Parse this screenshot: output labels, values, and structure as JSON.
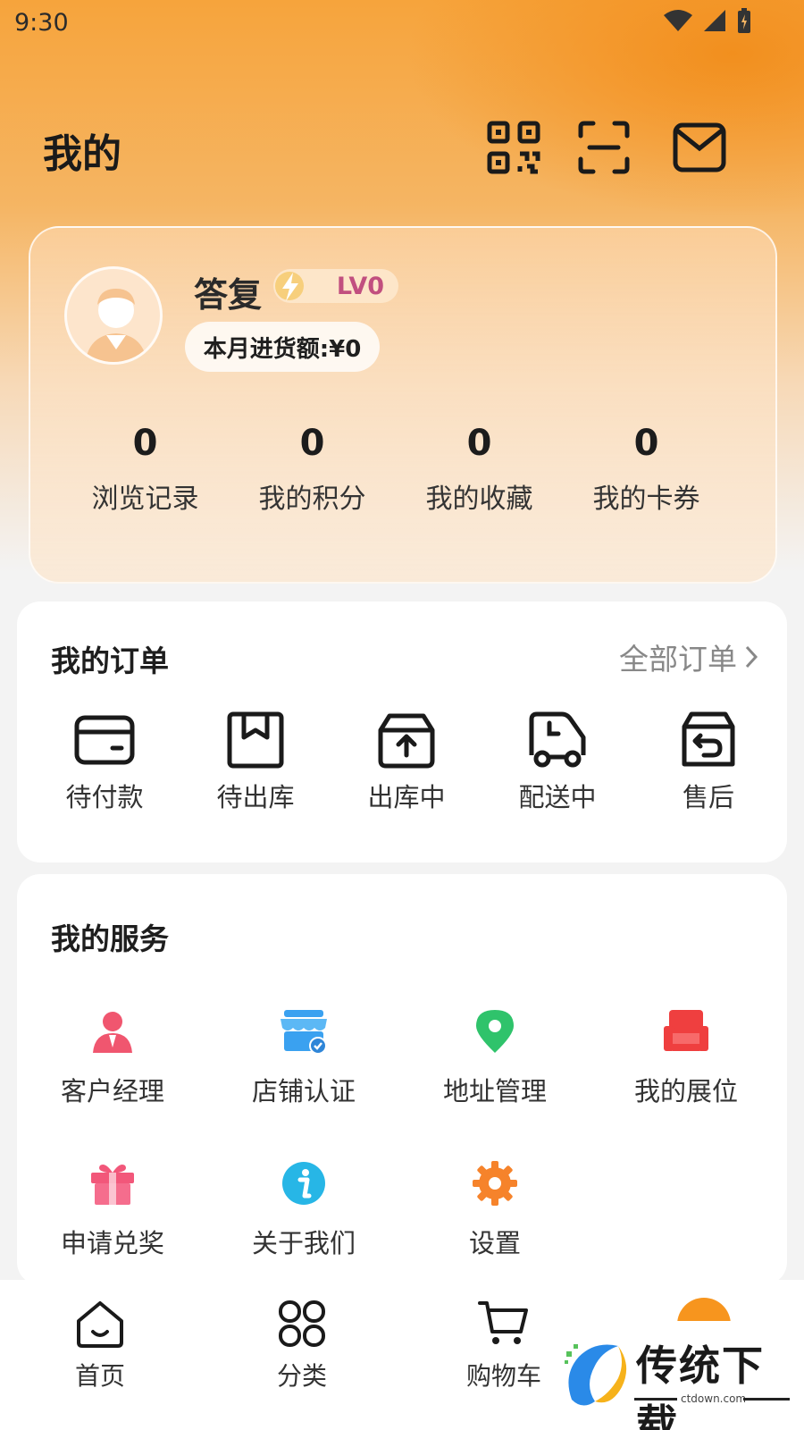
{
  "status": {
    "time": "9:30"
  },
  "header": {
    "title": "我的"
  },
  "profile": {
    "username": "答复",
    "level": "LV0",
    "purchase_label": "本月进货额:¥0",
    "stats": [
      {
        "value": "0",
        "label": "浏览记录"
      },
      {
        "value": "0",
        "label": "我的积分"
      },
      {
        "value": "0",
        "label": "我的收藏"
      },
      {
        "value": "0",
        "label": "我的卡券"
      }
    ]
  },
  "orders": {
    "title": "我的订单",
    "all_label": "全部订单",
    "items": [
      {
        "label": "待付款",
        "icon": "wallet-icon"
      },
      {
        "label": "待出库",
        "icon": "package-icon"
      },
      {
        "label": "出库中",
        "icon": "box-upload-icon"
      },
      {
        "label": "配送中",
        "icon": "truck-icon"
      },
      {
        "label": "售后",
        "icon": "return-box-icon"
      }
    ]
  },
  "services": {
    "title": "我的服务",
    "items": [
      {
        "label": "客户经理",
        "icon": "manager-icon",
        "color": "#f0566f"
      },
      {
        "label": "店铺认证",
        "icon": "store-verify-icon",
        "color": "#3aa1f0"
      },
      {
        "label": "地址管理",
        "icon": "location-pin-icon",
        "color": "#2fc36b"
      },
      {
        "label": "我的展位",
        "icon": "sofa-icon",
        "color": "#ef3f3f"
      },
      {
        "label": "申请兑奖",
        "icon": "gift-icon",
        "color": "#f2577a"
      },
      {
        "label": "关于我们",
        "icon": "info-icon",
        "color": "#27b6e6"
      },
      {
        "label": "设置",
        "icon": "gear-icon",
        "color": "#f6832b"
      }
    ]
  },
  "tabbar": {
    "items": [
      {
        "label": "首页",
        "icon": "home-icon"
      },
      {
        "label": "分类",
        "icon": "category-icon"
      },
      {
        "label": "购物车",
        "icon": "cart-icon"
      }
    ]
  },
  "watermark": {
    "text": "传统下载",
    "url": "ctdown.com"
  },
  "colors": {
    "accent": "#f7951e",
    "level_text": "#c14f7f"
  }
}
